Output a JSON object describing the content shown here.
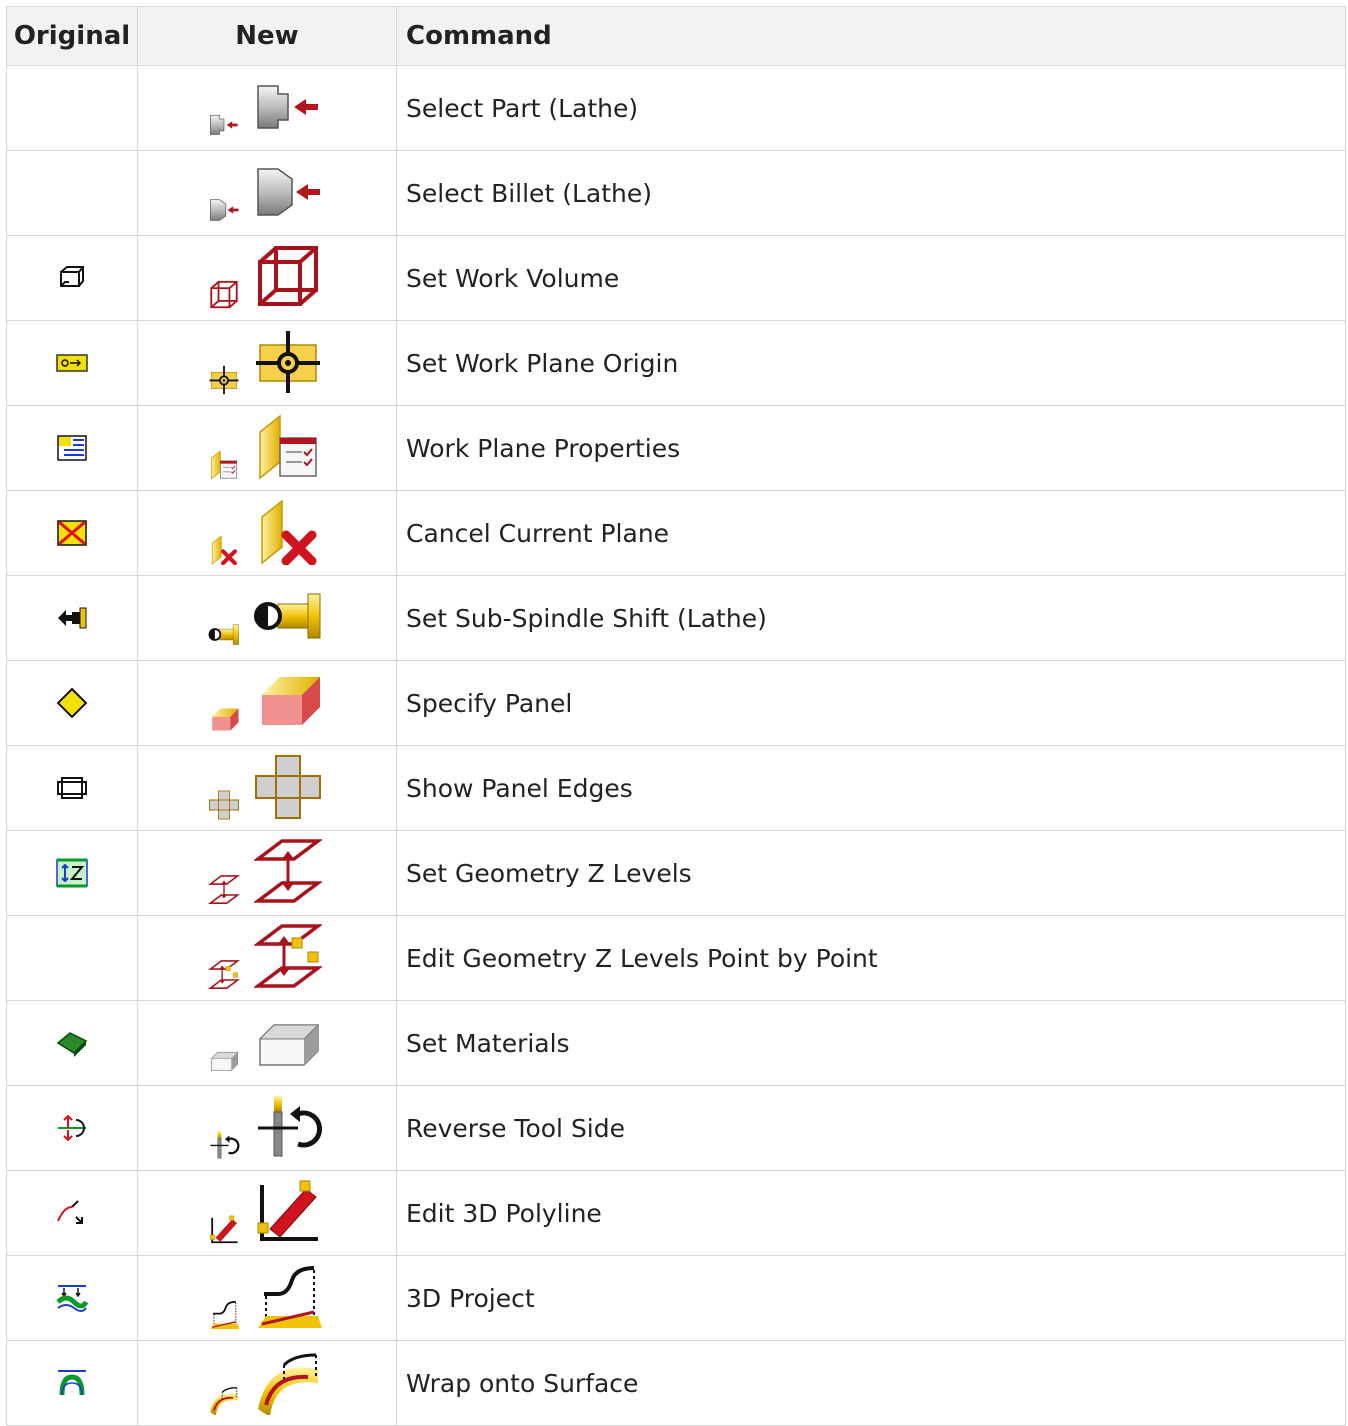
{
  "table": {
    "headers": [
      "Original",
      "New",
      "Command"
    ],
    "rows": [
      {
        "command": "Select Part (Lathe)",
        "original_icon": "",
        "new_icon": "select-part-lathe-icon"
      },
      {
        "command": "Select Billet (Lathe)",
        "original_icon": "",
        "new_icon": "select-billet-lathe-icon"
      },
      {
        "command": "Set Work Volume",
        "original_icon": "wireframe-box-icon",
        "new_icon": "red-wireframe-cube-icon"
      },
      {
        "command": "Set Work Plane Origin",
        "original_icon": "origin-arrow-icon",
        "new_icon": "crosshair-origin-icon"
      },
      {
        "command": "Work Plane Properties",
        "original_icon": "plane-properties-icon",
        "new_icon": "plane-checklist-icon"
      },
      {
        "command": "Cancel Current Plane",
        "original_icon": "red-cross-box-icon",
        "new_icon": "plane-red-x-icon"
      },
      {
        "command": "Set Sub-Spindle Shift (Lathe)",
        "original_icon": "spindle-black-icon",
        "new_icon": "spindle-gold-icon"
      },
      {
        "command": "Specify Panel",
        "original_icon": "yellow-diamond-icon",
        "new_icon": "panel-block-icon"
      },
      {
        "command": "Show Panel Edges",
        "original_icon": "panel-edges-icon",
        "new_icon": "panel-cross-icon"
      },
      {
        "command": "Set Geometry Z Levels",
        "original_icon": "z-level-icon",
        "new_icon": "z-levels-planes-icon"
      },
      {
        "command": "Edit Geometry Z Levels Point by Point",
        "original_icon": "",
        "new_icon": "z-levels-points-icon"
      },
      {
        "command": "Set Materials",
        "original_icon": "green-block-icon",
        "new_icon": "grey-block-icon"
      },
      {
        "command": "Reverse Tool Side",
        "original_icon": "reverse-arrows-icon",
        "new_icon": "tool-reverse-icon"
      },
      {
        "command": "Edit 3D Polyline",
        "original_icon": "polyline-curve-icon",
        "new_icon": "pencil-polyline-icon"
      },
      {
        "command": "3D Project",
        "original_icon": "project-wave-icon",
        "new_icon": "project-profile-icon"
      },
      {
        "command": "Wrap onto Surface",
        "original_icon": "wrap-icon",
        "new_icon": "wrap-surface-icon"
      }
    ]
  },
  "colors": {
    "header_bg": "#f2f2f2",
    "border": "#d6d6d6",
    "accent_red": "#a8121b",
    "accent_gold": "#f2c20a"
  }
}
